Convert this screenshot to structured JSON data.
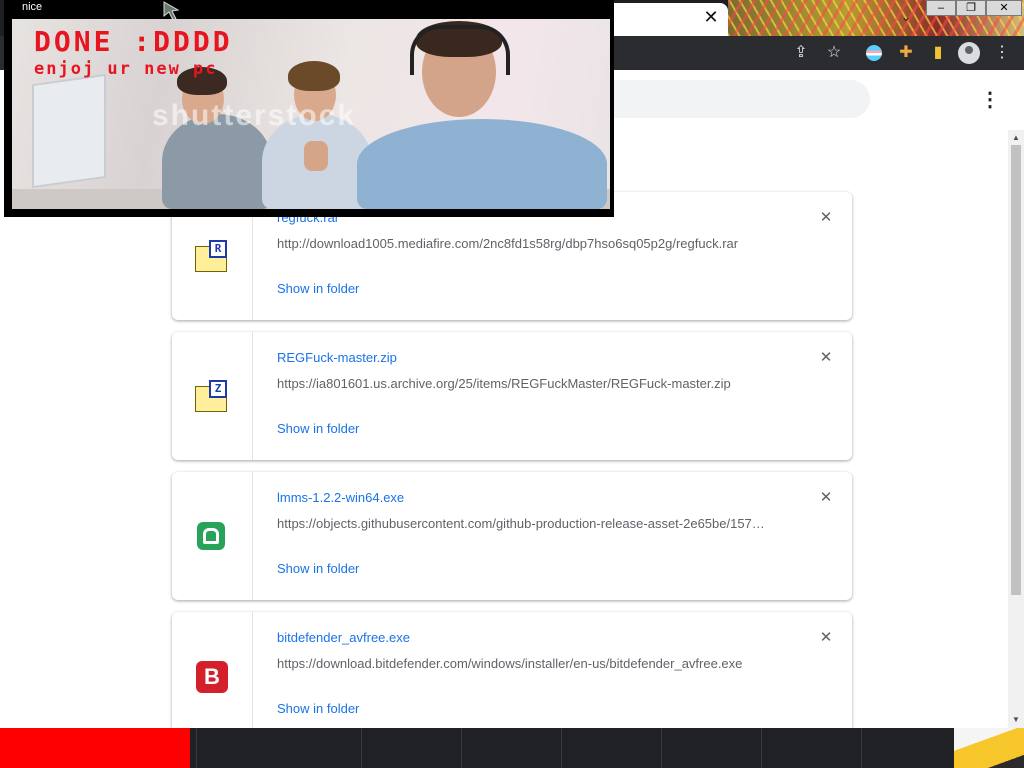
{
  "popup": {
    "title": "nice",
    "image": {
      "headline": "DONE :DDDD",
      "subline": "enjoj ur new pc",
      "watermark": "shutterstock"
    }
  },
  "browser": {
    "tab_close": "✕",
    "new_tab": "+",
    "tab_search": "⌄",
    "window_buttons": {
      "minimize": "–",
      "restore": "❐",
      "close": "✕"
    },
    "toolbar_icons": {
      "share": "⇪",
      "bookmark": "☆",
      "extensions": "✚",
      "sidebar": "▮",
      "menu": "⋮"
    }
  },
  "downloads": {
    "page_menu": "⋮",
    "show_in_folder": "Show in folder",
    "remove": "✕",
    "items": [
      {
        "name": "regfuck.rar",
        "url": "http://download1005.mediafire.com/2nc8fd1s58rg/dbp7hso6sq05p2g/regfuck.rar",
        "icon": "winrar-archive-icon",
        "badge": "R"
      },
      {
        "name": "REGFuck-master.zip",
        "url": "https://ia801601.us.archive.org/25/items/REGFuckMaster/REGFuck-master.zip",
        "icon": "zip-archive-icon",
        "badge": "Z"
      },
      {
        "name": "lmms-1.2.2-win64.exe",
        "url": "https://objects.githubusercontent.com/github-production-release-asset-2e65be/157…",
        "icon": "lmms-app-icon"
      },
      {
        "name": "bitdefender_avfree.exe",
        "url": "https://download.bitdefender.com/windows/installer/en-us/bitdefender_avfree.exe",
        "icon": "bitdefender-app-icon",
        "badge": "B"
      }
    ]
  },
  "colors": {
    "link": "#1a73e8",
    "done_text": "#e8141f",
    "taskbar_start": "#ff0000",
    "lmms_green": "#27a35a",
    "bitdefender_red": "#d3202a"
  }
}
